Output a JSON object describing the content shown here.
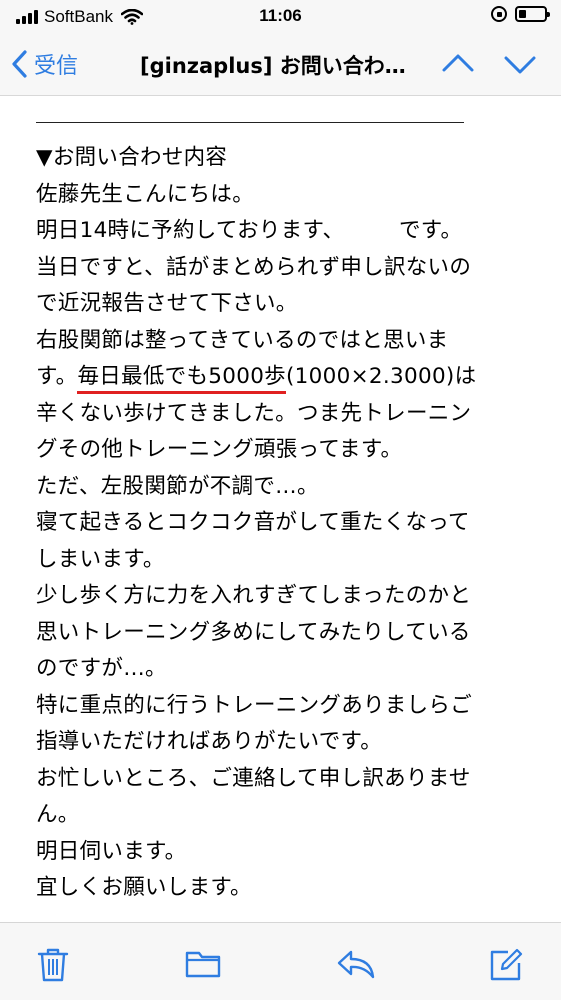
{
  "status_bar": {
    "carrier": "SoftBank",
    "time": "11:06",
    "battery_level": 0.28
  },
  "nav": {
    "back_label": "受信",
    "title": "[ginzaplus] お問い合わ…"
  },
  "message": {
    "lines": [
      "▼お問い合わせ内容",
      "佐藤先生こんにちは。",
      "明日14時に予約しております、　　　です。",
      "当日ですと、話がまとめられず申し訳ないの",
      "で近況報告させて下さい。",
      "右股関節は整ってきているのではと思いま",
      {
        "pre": "す。",
        "highlight": "毎日最低でも5000歩",
        "post": "(1000×2.3000)は"
      },
      "辛くない歩けてきました。つま先トレーニン",
      "グその他トレーニング頑張ってます。",
      "ただ、左股関節が不調で…。",
      "寝て起きるとコクコク音がして重たくなって",
      "しまいます。",
      "少し歩く方に力を入れすぎてしまったのかと",
      "思いトレーニング多めにしてみたりしている",
      "のですが…。",
      "特に重点的に行うトレーニングありましらご",
      "指導いただければありがたいです。",
      "お忙しいところ、ご連絡して申し訳ありませ",
      "ん。",
      "明日伺います。",
      "宜しくお願いします。"
    ]
  },
  "toolbar": {
    "icons": [
      "trash-icon",
      "folder-icon",
      "reply-icon",
      "compose-icon"
    ]
  },
  "colors": {
    "accent": "#2f7de1",
    "underline": "#e02020"
  }
}
